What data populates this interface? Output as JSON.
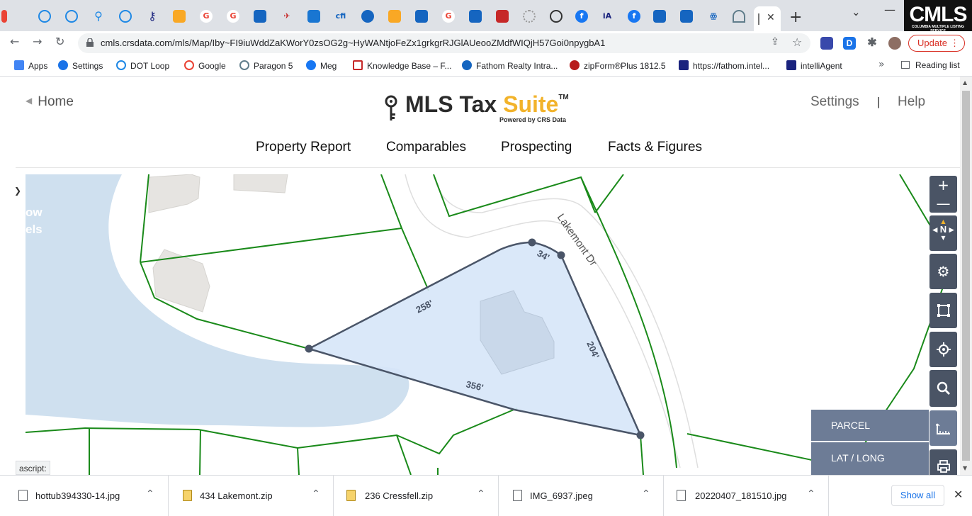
{
  "browser": {
    "url": "cmls.crsdata.com/mls/Map/Iby~FI9iuWddZaKWorY0zsOG2g~HyWANtjoFeZx1grkgrRJGlAUeooZMdfWIQjH57Goi0npygbA1",
    "update_label": "Update",
    "corner_logo": "CMLS",
    "corner_logo_sub": "COLUMBIA MULTIPLE LISTING SERVICE",
    "bookmarks": [
      {
        "label": "Apps",
        "color": "#4285f4"
      },
      {
        "label": "Settings",
        "color": "#1a73e8"
      },
      {
        "label": "DOT Loop",
        "color": "#1e88e5"
      },
      {
        "label": "Google",
        "color": "#ea4335"
      },
      {
        "label": "Paragon 5",
        "color": "#607d8b"
      },
      {
        "label": "Meg",
        "color": "#1877f2"
      },
      {
        "label": "Knowledge Base – F...",
        "color": "#c62828"
      },
      {
        "label": "Fathom Realty Intra...",
        "color": "#1565c0"
      },
      {
        "label": "zipForm®Plus 1812.5",
        "color": "#b71c1c"
      },
      {
        "label": "https://fathom.intel...",
        "color": "#1a237e"
      },
      {
        "label": "intelliAgent",
        "color": "#1a237e"
      }
    ],
    "reading_list": "Reading list"
  },
  "header": {
    "home": "Home",
    "logo_main": "MLS Tax ",
    "logo_accent": "Suite",
    "logo_tm": "TM",
    "logo_powered": "Powered by CRS Data",
    "settings": "Settings",
    "separator": "|",
    "help": "Help"
  },
  "nav": {
    "items": [
      "Property Report",
      "Comparables",
      "Prospecting",
      "Facts & Figures"
    ]
  },
  "map": {
    "street_name": "Lakemont Dr",
    "side_text_1": "ow",
    "side_text_2": "els",
    "dimensions": [
      "34'",
      "258'",
      "204'",
      "356'"
    ],
    "layers": [
      "PARCEL",
      "LAT / LONG"
    ],
    "controls": [
      "zoom-in",
      "zoom-out",
      "compass",
      "settings",
      "select-area",
      "locate",
      "search",
      "measure",
      "print"
    ],
    "compass_label": "N",
    "colors": {
      "water": "#cfe0ef",
      "parcel_line": "#1a8a1a",
      "selected_fill": "#d6e6f8",
      "selected_stroke": "#4a5568",
      "control": "#4a5465",
      "layer": "#6d7c96"
    }
  },
  "status_tip": "ascript:",
  "downloads": {
    "items": [
      {
        "name": "hottub394330-14.jpg",
        "type": "image"
      },
      {
        "name": "434 Lakemont.zip",
        "type": "zip"
      },
      {
        "name": "236 Cressfell.zip",
        "type": "zip"
      },
      {
        "name": "IMG_6937.jpeg",
        "type": "image"
      },
      {
        "name": "20220407_181510.jpg",
        "type": "image"
      }
    ],
    "show_all": "Show all"
  }
}
